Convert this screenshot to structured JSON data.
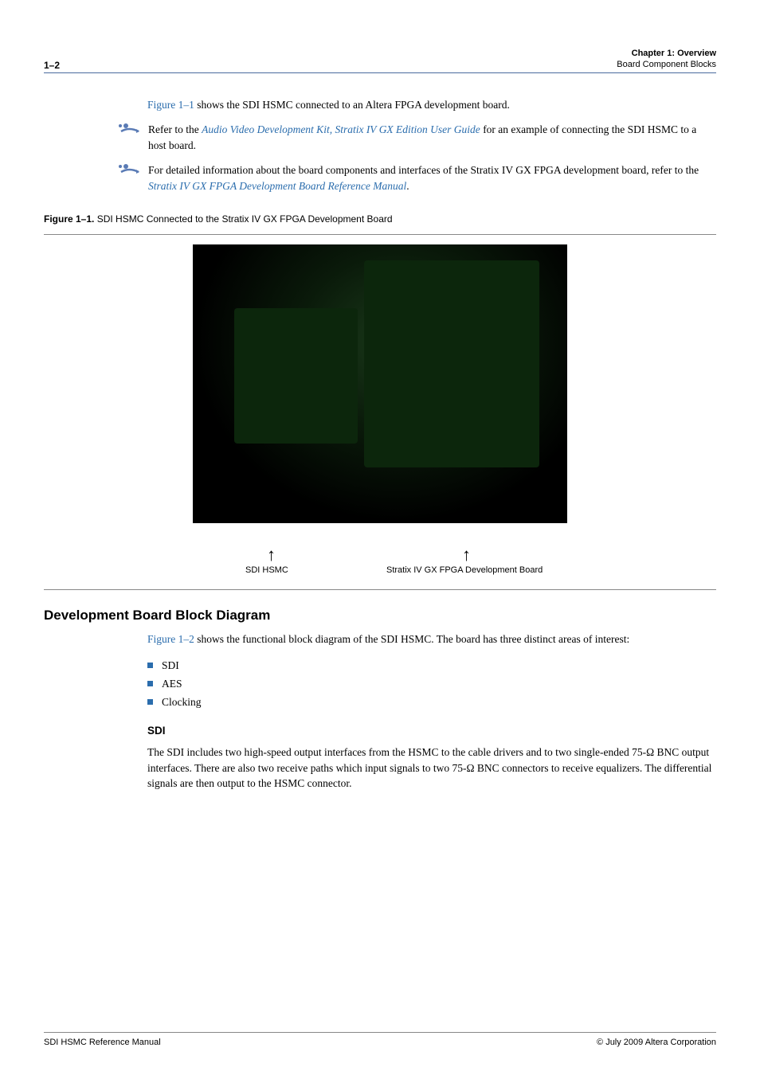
{
  "header": {
    "page_number": "1–2",
    "chapter_line": "Chapter 1: Overview",
    "section_line": "Board Component Blocks"
  },
  "intro_para": {
    "fig_ref": "Figure 1–1",
    "rest": " shows the SDI HSMC connected to an Altera FPGA development board."
  },
  "note1": {
    "pre": "Refer to the ",
    "link": "Audio Video Development Kit, Stratix IV GX Edition User Guide",
    "post": " for an example of connecting the SDI HSMC to a host board."
  },
  "note2": {
    "pre": "For detailed information about the board components and interfaces of the Stratix IV GX FPGA development board, refer to the ",
    "link": "Stratix IV GX FPGA Development Board Reference Manual",
    "post": "."
  },
  "figure": {
    "label": "Figure 1–1.",
    "caption": "SDI HSMC Connected to the Stratix IV GX FPGA Development Board",
    "callout_left": "SDI HSMC",
    "callout_right": "Stratix IV GX FPGA Development Board"
  },
  "section": {
    "title": "Development Board Block Diagram",
    "para": {
      "fig_ref": "Figure 1–2",
      "rest": " shows the functional block diagram of the SDI HSMC. The board has three distinct areas of interest:"
    },
    "bullets": [
      "SDI",
      "AES",
      "Clocking"
    ],
    "sub": {
      "title": "SDI",
      "para": "The SDI includes two high-speed output interfaces from the HSMC to the cable drivers and to two single-ended 75-Ω BNC output interfaces. There are also two receive paths which input signals to two 75-Ω BNC connectors to receive equalizers. The differential signals are then output to the HSMC connector."
    }
  },
  "footer": {
    "left": "SDI HSMC Reference Manual",
    "right": "© July 2009   Altera Corporation"
  }
}
